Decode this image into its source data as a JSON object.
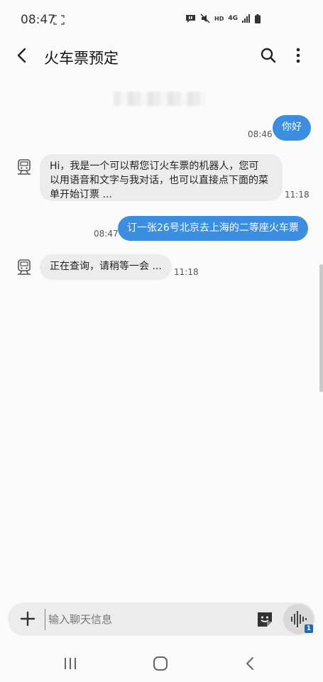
{
  "status": {
    "time": "08:47",
    "network_label": "HD",
    "signal_type": "4G",
    "icons": [
      "screenshot-icon",
      "chat-notification-icon",
      "mute-icon",
      "hd-icon",
      "4g-icon",
      "signal-icon",
      "battery-icon"
    ]
  },
  "appbar": {
    "title": "火车票预定",
    "icons": [
      "back-arrow-icon",
      "search-icon",
      "more-vertical-icon"
    ]
  },
  "messages": [
    {
      "direction": "outgoing",
      "text": "你好",
      "time": "08:46"
    },
    {
      "direction": "incoming",
      "lines": [
        "Hi，我是一个可以帮您订火车票的机器人，您可",
        "以用语音和文字与我对话，也可以直接点下面的菜",
        "单开始订票 ..."
      ],
      "time": "11:18",
      "avatar": "train-bot-icon"
    },
    {
      "direction": "outgoing",
      "text": "订一张26号北京去上海的二等座火车票",
      "time": "08:47"
    },
    {
      "direction": "incoming",
      "lines": [
        "正在查询，请稍等一会 ..."
      ],
      "time": "11:18",
      "avatar": "train-bot-icon"
    }
  ],
  "composer": {
    "placeholder": "输入聊天信息",
    "voice_badge": "1",
    "icons": [
      "plus-icon",
      "sticker-icon",
      "voice-wave-icon"
    ]
  },
  "navbar": {
    "icons": [
      "recent-apps-icon",
      "home-icon",
      "nav-back-icon"
    ]
  },
  "colors": {
    "accent": "#3b8ee0",
    "incoming_bubble": "#ececec",
    "background": "#fbfbfb"
  }
}
